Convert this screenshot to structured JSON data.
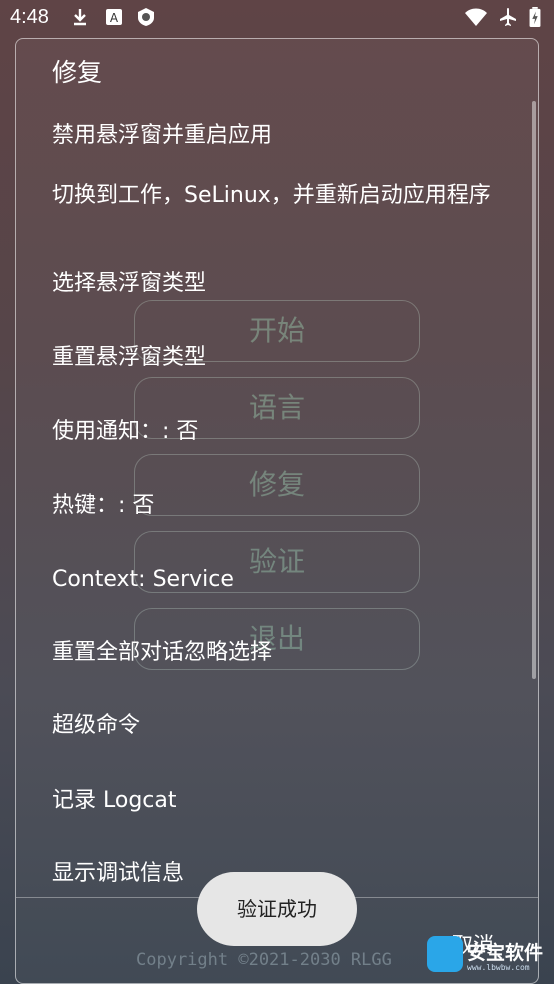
{
  "status_bar": {
    "time": "4:48",
    "icons_left": [
      "download-icon",
      "a-badge-icon",
      "shield-icon"
    ],
    "icons_right": [
      "wifi-icon",
      "airplane-icon",
      "battery-icon"
    ]
  },
  "background_app": {
    "buttons": [
      "开始",
      "语言",
      "修复",
      "验证",
      "退出"
    ],
    "copyright": "Copyright ©2021-2030 RLGG"
  },
  "dialog": {
    "title": "修复",
    "items": [
      "禁用悬浮窗并重启应用",
      "切换到工作，SeLinux，并重新启动应用程序",
      "选择悬浮窗类型",
      "重置悬浮窗类型",
      "使用通知：: 否",
      "热键：: 否",
      "Context: Service",
      "重置全部对话忽略选择",
      "超级命令",
      "记录 Logcat",
      "显示调试信息"
    ],
    "cancel_label": "取消"
  },
  "toast": {
    "text": "验证成功"
  },
  "watermark": {
    "text": "安宝软件",
    "sub": "www.lbwbw.com"
  }
}
